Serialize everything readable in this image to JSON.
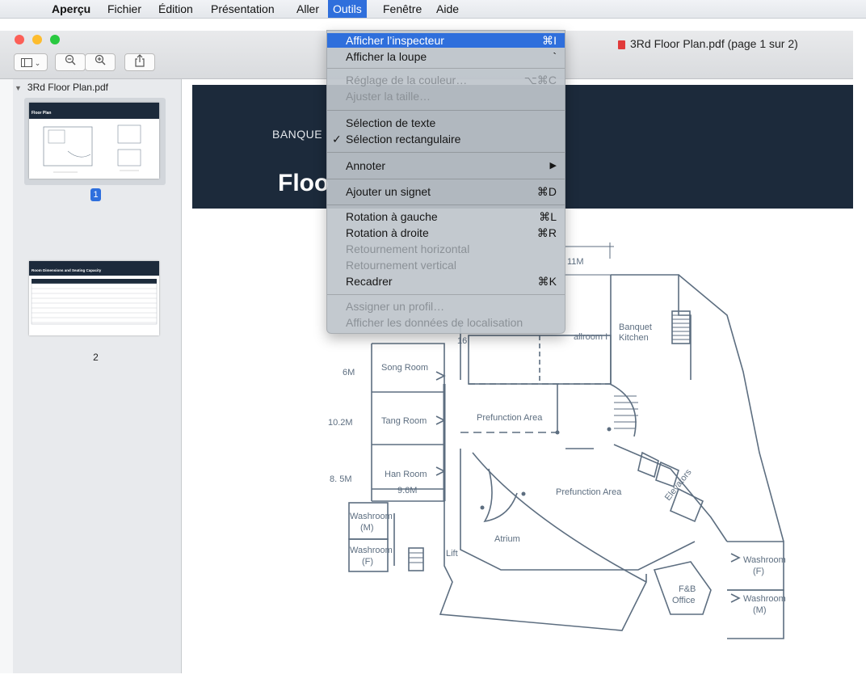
{
  "menubar": {
    "app_name": "Aperçu",
    "items": [
      "Fichier",
      "Édition",
      "Présentation",
      "Aller",
      "Outils",
      "Fenêtre",
      "Aide"
    ],
    "active_item": "Outils"
  },
  "window": {
    "title": "3Rd Floor Plan.pdf (page 1 sur 2)"
  },
  "sidebar": {
    "file_name": "3Rd Floor Plan.pdf",
    "pages": [
      "1",
      "2"
    ],
    "selected_page": "1",
    "thumb1_title": "Floor Plan",
    "thumb2_title": "Room Dimensions and Seating Capacity"
  },
  "document": {
    "banner_text": "BANQUE",
    "heading_text": "Floo",
    "plan_labels": {
      "m11": "11M",
      "ballroom": "allroom I",
      "m16": "16",
      "banquet_kitchen_1": "Banquet",
      "banquet_kitchen_2": "Kitchen",
      "m6": "6M",
      "song_room": "Song Room",
      "m10_2": "10.2M",
      "tang_room": "Tang Room",
      "prefunction_1": "Prefunction Area",
      "m8_5": "8. 5M",
      "han_room": "Han Room",
      "m9_6": "9.6M",
      "prefunction_2": "Prefunction Area",
      "elevators": "Elevators",
      "washroom_m_1": "Washroom",
      "washroom_m_2": "(M)",
      "atrium": "Atrium",
      "washroom_f_1": "Washroom",
      "washroom_f_2": "(F)",
      "lift": "Lift",
      "washroom_f_r1": "Washroom",
      "washroom_f_r2": "(F)",
      "fb_office_1": "F&B",
      "fb_office_2": "Office",
      "washroom_m_r1": "Washroom",
      "washroom_m_r2": "(M)"
    }
  },
  "menu": {
    "afficher_inspecteur": {
      "label": "Afficher l’inspecteur",
      "shortcut": "⌘I"
    },
    "afficher_loupe": {
      "label": "Afficher la loupe",
      "shortcut": "`"
    },
    "reglage_couleur": {
      "label": "Réglage de la couleur…",
      "shortcut": "⌥⌘C"
    },
    "ajuster_taille": {
      "label": "Ajuster la taille…"
    },
    "selection_texte": {
      "label": "Sélection de texte"
    },
    "selection_rect": {
      "label": "Sélection rectangulaire",
      "check": "✓"
    },
    "annoter": {
      "label": "Annoter",
      "arrow": "▶"
    },
    "ajouter_signet": {
      "label": "Ajouter un signet",
      "shortcut": "⌘D"
    },
    "rotation_gauche": {
      "label": "Rotation à gauche",
      "shortcut": "⌘L"
    },
    "rotation_droite": {
      "label": "Rotation à droite",
      "shortcut": "⌘R"
    },
    "retournement_h": {
      "label": "Retournement horizontal"
    },
    "retournement_v": {
      "label": "Retournement vertical"
    },
    "recadrer": {
      "label": "Recadrer",
      "shortcut": "⌘K"
    },
    "assigner_profil": {
      "label": "Assigner un profil…"
    },
    "donnees_localisation": {
      "label": "Afficher les données de localisation"
    }
  },
  "colors": {
    "accent": "#2f6fdc",
    "doc_header": "#1c2a3b",
    "plan_line": "#5d6e80"
  }
}
